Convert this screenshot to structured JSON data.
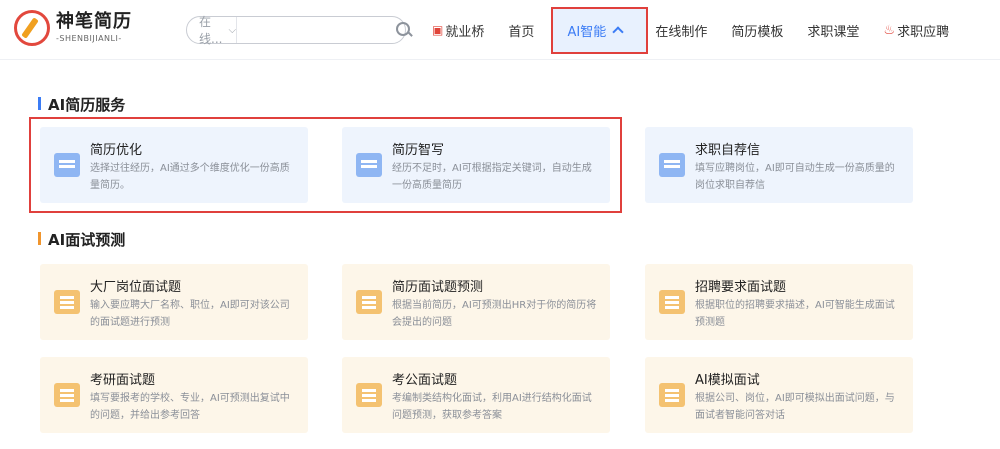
{
  "logo": {
    "title": "神笔简历",
    "subtitle": "-SHENBIJIANLI-"
  },
  "search": {
    "scope": "在线...",
    "placeholder": ""
  },
  "nav": {
    "items": [
      {
        "label": "就业桥"
      },
      {
        "label": "首页"
      },
      {
        "label": "AI智能"
      },
      {
        "label": "在线制作"
      },
      {
        "label": "简历模板"
      },
      {
        "label": "求职课堂"
      },
      {
        "label": "求职应聘"
      }
    ]
  },
  "sections": [
    {
      "title": "AI简历服务",
      "cards": [
        {
          "title": "简历优化",
          "desc": "选择过往经历，AI通过多个维度优化一份高质量简历。",
          "icon": "resume-optimize-icon"
        },
        {
          "title": "简历智写",
          "desc": "经历不足时，AI可根据指定关键词，自动生成一份高质量简历",
          "icon": "resume-write-icon"
        },
        {
          "title": "求职自荐信",
          "desc": "填写应聘岗位，AI即可自动生成一份高质量的岗位求职自荐信",
          "icon": "cover-letter-icon"
        }
      ]
    },
    {
      "title": "AI面试预测",
      "cards": [
        {
          "title": "大厂岗位面试题",
          "desc": "输入要应聘大厂名称、职位，AI即可对该公司的面试题进行预测",
          "icon": "company-interview-icon"
        },
        {
          "title": "简历面试题预测",
          "desc": "根据当前简历，AI可预测出HR对于你的简历将会提出的问题",
          "icon": "resume-interview-icon"
        },
        {
          "title": "招聘要求面试题",
          "desc": "根据职位的招聘要求描述，AI可智能生成面试预测题",
          "icon": "requirement-interview-icon"
        },
        {
          "title": "考研面试题",
          "desc": "填写要报考的学校、专业，AI可预测出复试中的问题，并给出参考回答",
          "icon": "postgrad-interview-icon"
        },
        {
          "title": "考公面试题",
          "desc": "考编制类结构化面试，利用AI进行结构化面试问题预测，获取参考答案",
          "icon": "civil-service-interview-icon"
        },
        {
          "title": "AI模拟面试",
          "desc": "根据公司、岗位，AI即可模拟出面试问题，与面试者智能问答对话",
          "icon": "mock-interview-icon"
        }
      ]
    }
  ],
  "colors": {
    "accent": "#3b7cf5",
    "highlight": "#e0403c",
    "card_blue": "#eef4fd",
    "card_orange": "#fdf6e9"
  }
}
